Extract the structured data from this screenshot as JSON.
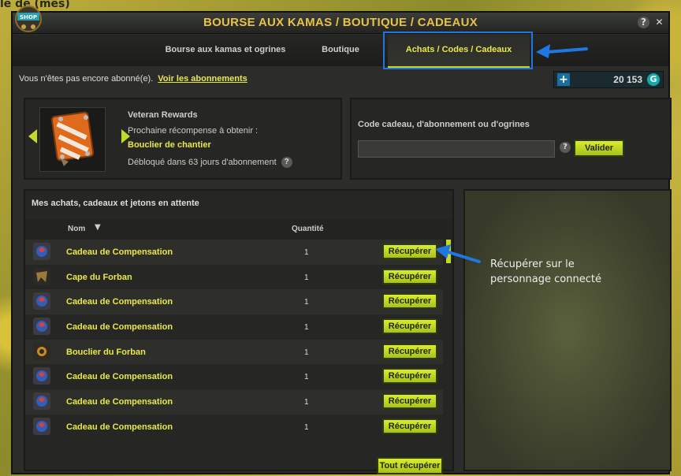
{
  "window": {
    "title": "BOURSE AUX KAMAS / BOUTIQUE / CADEAUX",
    "help": "?",
    "close": "✕"
  },
  "background_text": "le de (mes)",
  "tabs": [
    {
      "label": "Bourse aux kamas et ogrines",
      "active": false
    },
    {
      "label": "Boutique",
      "active": false
    },
    {
      "label": "Achats / Codes / Cadeaux",
      "active": true
    }
  ],
  "subscription": {
    "text": "Vous n'êtes pas encore abonné(e).",
    "link": "Voir les abonnements"
  },
  "balance": {
    "plus": "+",
    "value": "20 153",
    "icon": "ogrine-icon"
  },
  "rewards": {
    "title": "Veteran Rewards",
    "next_label": "Prochaine récompense à obtenir :",
    "item_name": "Bouclier de chantier",
    "unlock_text": "Débloqué dans 63 jours d'abonnement",
    "help": "?"
  },
  "code": {
    "label": "Code cadeau, d'abonnement ou d'ogrines",
    "placeholder": "",
    "help": "?",
    "submit": "Valider"
  },
  "list": {
    "title": "Mes achats, cadeaux et jetons en attente",
    "col_name": "Nom",
    "sort_icon": "▼",
    "col_qty": "Quantité",
    "claim_label": "Récupérer",
    "claim_all": "Tout récupérer",
    "rows": [
      {
        "name": "Cadeau de Compensation",
        "qty": "1",
        "icon": "gift-icon"
      },
      {
        "name": "Cape du Forban",
        "qty": "1",
        "icon": "cape-icon"
      },
      {
        "name": "Cadeau de Compensation",
        "qty": "1",
        "icon": "gift-icon"
      },
      {
        "name": "Cadeau de Compensation",
        "qty": "1",
        "icon": "gift-icon"
      },
      {
        "name": "Bouclier du Forban",
        "qty": "1",
        "icon": "shield-icon"
      },
      {
        "name": "Cadeau de Compensation",
        "qty": "1",
        "icon": "gift-icon"
      },
      {
        "name": "Cadeau de Compensation",
        "qty": "1",
        "icon": "gift-icon"
      },
      {
        "name": "Cadeau de Compensation",
        "qty": "1",
        "icon": "gift-icon"
      }
    ]
  },
  "annotation": {
    "line1": "Récupérer sur le",
    "line2": "personnage connecté"
  },
  "colors": {
    "accent": "#c3d92a",
    "highlight": "#1e78e0",
    "title": "#e8c24a",
    "item_text": "#e8e84a"
  }
}
